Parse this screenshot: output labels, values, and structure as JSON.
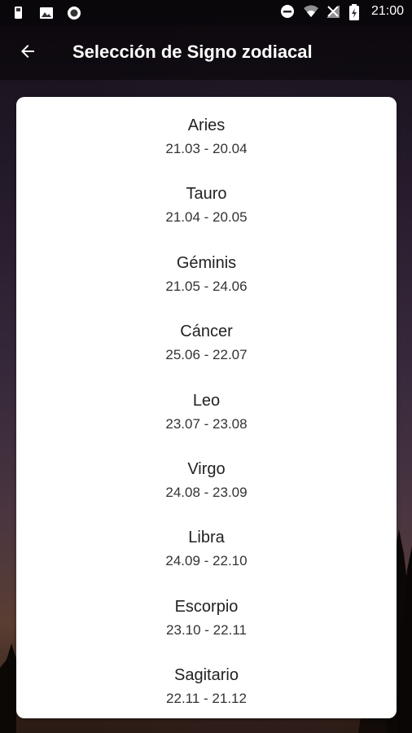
{
  "status_bar": {
    "left_icons": [
      "sim-card-icon",
      "image-notification-icon",
      "circle-notification-icon"
    ],
    "right_icons": [
      "do-not-disturb-icon",
      "wifi-icon",
      "no-signal-icon",
      "battery-icon"
    ],
    "time": "21:00"
  },
  "toolbar": {
    "back_icon": "arrow-left-icon",
    "title": "Selección de Signo zodiacal"
  },
  "signs": [
    {
      "name": "Aries",
      "dates": "21.03 - 20.04"
    },
    {
      "name": "Tauro",
      "dates": "21.04 - 20.05"
    },
    {
      "name": "Géminis",
      "dates": "21.05 - 24.06"
    },
    {
      "name": "Cáncer",
      "dates": "25.06 - 22.07"
    },
    {
      "name": "Leo",
      "dates": "23.07 - 23.08"
    },
    {
      "name": "Virgo",
      "dates": "24.08 - 23.09"
    },
    {
      "name": "Libra",
      "dates": "24.09 - 22.10"
    },
    {
      "name": "Escorpio",
      "dates": "23.10 - 22.11"
    },
    {
      "name": "Sagitario",
      "dates": "22.11 - 21.12"
    }
  ],
  "colors": {
    "card_background": "#ffffff",
    "text_primary": "#222222",
    "toolbar_text": "#ffffff"
  }
}
